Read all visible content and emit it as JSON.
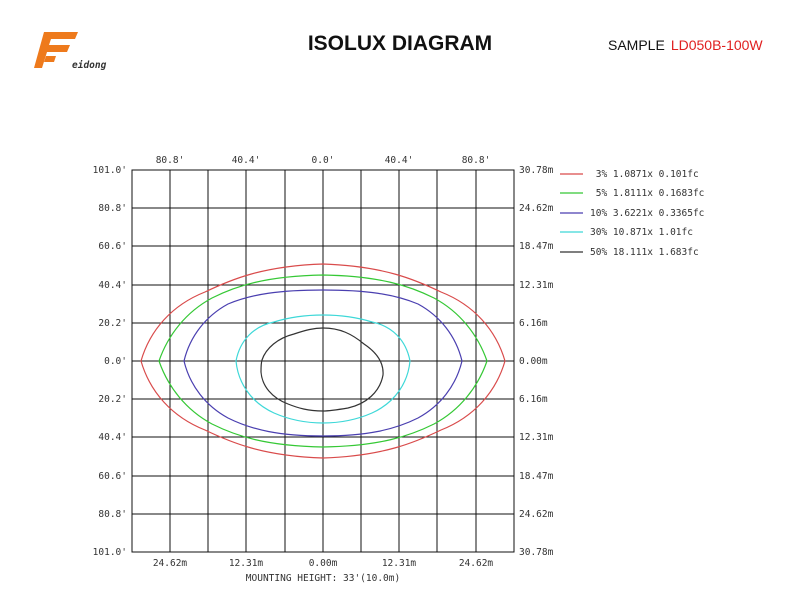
{
  "header": {
    "logo_text": "Feidong",
    "title": "ISOLUX DIAGRAM",
    "sample_label": "SAMPLE",
    "sample_code": "LD050B-100W"
  },
  "colors": {
    "logo": "#ee7a1c",
    "sample_code": "#e02020",
    "grid": "#111111",
    "contour_3": "#d94b4b",
    "contour_5": "#35c835",
    "contour_10": "#4a3fb0",
    "contour_30": "#3ed8d8",
    "contour_50": "#333333"
  },
  "diagram": {
    "top_labels": [
      "80.8'",
      "40.4'",
      "0.0'",
      "40.4'",
      "80.8'"
    ],
    "left_labels": [
      "101.0'",
      "80.8'",
      "60.6'",
      "40.4'",
      "20.2'",
      "0.0'",
      "20.2'",
      "40.4'",
      "60.6'",
      "80.8'",
      "101.0'"
    ],
    "right_labels": [
      "30.78m",
      "24.62m",
      "18.47m",
      "12.31m",
      "6.16m",
      "0.00m",
      "6.16m",
      "12.31m",
      "18.47m",
      "24.62m",
      "30.78m"
    ],
    "bottom_labels": [
      "24.62m",
      "12.31m",
      "0.00m",
      "12.31m",
      "24.62m"
    ],
    "mounting_height": "MOUNTING HEIGHT: 33'(10.0m)"
  },
  "legend": [
    {
      "text": " 3% 1.0871x 0.101fc",
      "color": "#d94b4b"
    },
    {
      "text": " 5% 1.8111x 0.1683fc",
      "color": "#35c835"
    },
    {
      "text": "10% 3.6221x 0.3365fc",
      "color": "#4a3fb0"
    },
    {
      "text": "30% 10.871x 1.01fc",
      "color": "#3ed8d8"
    },
    {
      "text": "50% 18.111x 1.683fc",
      "color": "#333333"
    }
  ]
}
